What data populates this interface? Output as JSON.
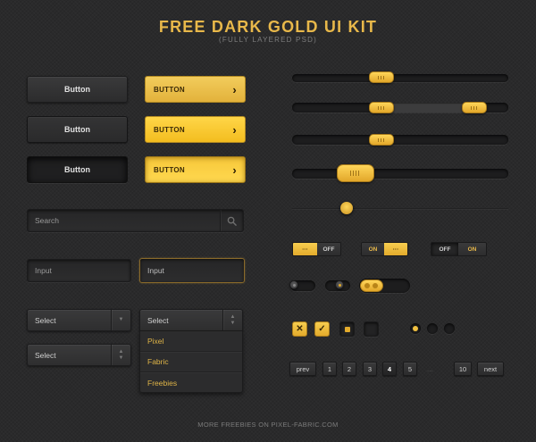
{
  "header": {
    "title": "FREE DARK GOLD UI KIT",
    "subtitle": "(FULLY LAYERED PSD)"
  },
  "footer": {
    "text": "MORE FREEBIES ON PIXEL-FABRIC.COM"
  },
  "buttons": {
    "dark_label": "Button",
    "gold_label": "BUTTON"
  },
  "search": {
    "placeholder": "Search",
    "icon": "search-icon"
  },
  "inputs": {
    "normal_placeholder": "Input",
    "focused_placeholder": "Input"
  },
  "selects": {
    "select1": "Select",
    "select2": "Select",
    "select3": "Select",
    "options": [
      "Pixel",
      "Fabric",
      "Freebies"
    ]
  },
  "sliders": {
    "single_value": 0.4,
    "range_values": [
      0.4,
      0.89
    ],
    "single2_value": 0.4,
    "large_value": 0.25
  },
  "toggles": {
    "dots": "···",
    "off": "OFF",
    "on": "ON"
  },
  "pagination": {
    "prev": "prev",
    "pages": [
      "1",
      "2",
      "3",
      "4",
      "5"
    ],
    "current": "4",
    "ellipsis": "...",
    "last": "10",
    "next": "next"
  },
  "colors": {
    "accent": "#e8b84a",
    "background": "#2a2a2b"
  }
}
